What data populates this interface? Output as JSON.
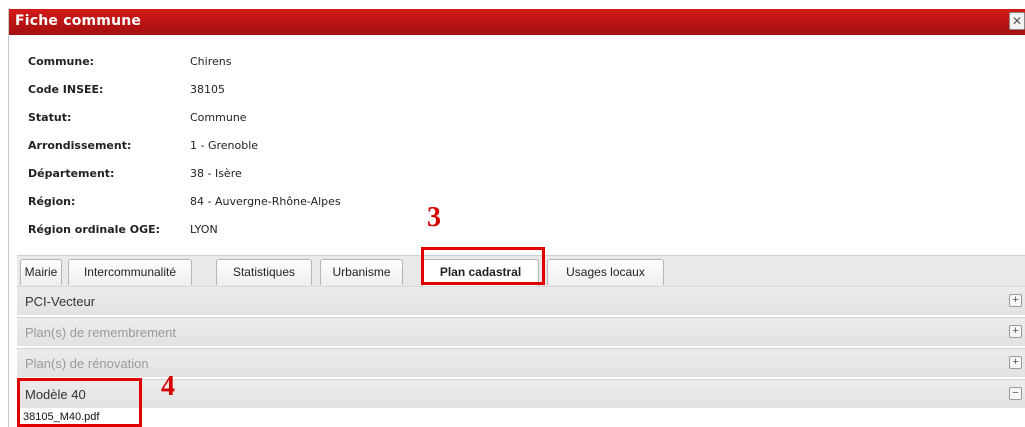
{
  "window": {
    "title": "Fiche commune",
    "close_glyph": "✕"
  },
  "info": [
    {
      "label": "Commune:",
      "value": "Chirens"
    },
    {
      "label": "Code INSEE:",
      "value": "38105"
    },
    {
      "label": "Statut:",
      "value": "Commune"
    },
    {
      "label": "Arrondissement:",
      "value": "1 - Grenoble"
    },
    {
      "label": "Département:",
      "value": "38 - Isère"
    },
    {
      "label": "Région:",
      "value": "84 - Auvergne-Rhône-Alpes"
    },
    {
      "label": "Région ordinale OGE:",
      "value": "LYON"
    }
  ],
  "tabs": [
    {
      "label": "Mairie"
    },
    {
      "label": "Intercommunalité"
    },
    {
      "label": "Statistiques"
    },
    {
      "label": "Urbanisme"
    },
    {
      "label": "Plan cadastral",
      "active": true
    },
    {
      "label": "Usages locaux"
    }
  ],
  "accordion": [
    {
      "label": "PCI-Vecteur",
      "toggle": "+",
      "enabled": true,
      "color": "#333333"
    },
    {
      "label": "Plan(s) de remembrement",
      "toggle": "+",
      "enabled": false,
      "color": "#9a9a9a"
    },
    {
      "label": "Plan(s) de rénovation",
      "toggle": "+",
      "enabled": false,
      "color": "#9a9a9a"
    },
    {
      "label": "Modèle 40",
      "toggle": "−",
      "enabled": true,
      "color": "#333333"
    }
  ],
  "attachment": {
    "file_name": "38105_M40.pdf"
  },
  "annotations": {
    "marker_tab": "3",
    "marker_model": "4",
    "color": "#e00000"
  }
}
